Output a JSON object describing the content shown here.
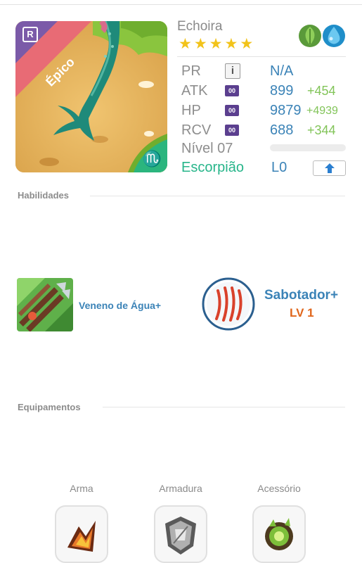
{
  "hero": {
    "name": "Echoira",
    "rarity": "Épico",
    "rarity_badge": "R",
    "stars": [
      "★",
      "★",
      "★",
      "★",
      "★"
    ],
    "elements": [
      "leaf-icon",
      "water-drop-icon"
    ],
    "zodiac_glyph": "♏"
  },
  "stats": {
    "pr": {
      "label": "PR",
      "info": "i",
      "value": "N/A"
    },
    "atk": {
      "label": "ATK",
      "rank": "00",
      "value": "899",
      "bonus": "+454"
    },
    "hp": {
      "label": "HP",
      "rank": "00",
      "value": "9879",
      "bonus": "+4939"
    },
    "rcv": {
      "label": "RCV",
      "rank": "00",
      "value": "688",
      "bonus": "+344"
    },
    "level": {
      "label": "Nível 07",
      "progress": 0
    },
    "zodiac": {
      "label": "Escorpião",
      "value": "L0"
    }
  },
  "skills_section": {
    "title": "Habilidades",
    "skill1": {
      "name": "Veneno de Água+"
    },
    "skill2": {
      "name": "Sabotador+",
      "level": "LV 1"
    }
  },
  "equipment_section": {
    "title": "Equipamentos",
    "slots": [
      {
        "label": "Arma"
      },
      {
        "label": "Armadura"
      },
      {
        "label": "Acessório"
      }
    ]
  },
  "colors": {
    "value_blue": "#3b83b7",
    "bonus_green": "#82c459",
    "zodiac_green": "#27b58a",
    "level_orange": "#e0661b",
    "star_gold": "#f2c31a",
    "rarity_ribbon": "#e86b75",
    "badge_purple": "#5b3f8f"
  }
}
